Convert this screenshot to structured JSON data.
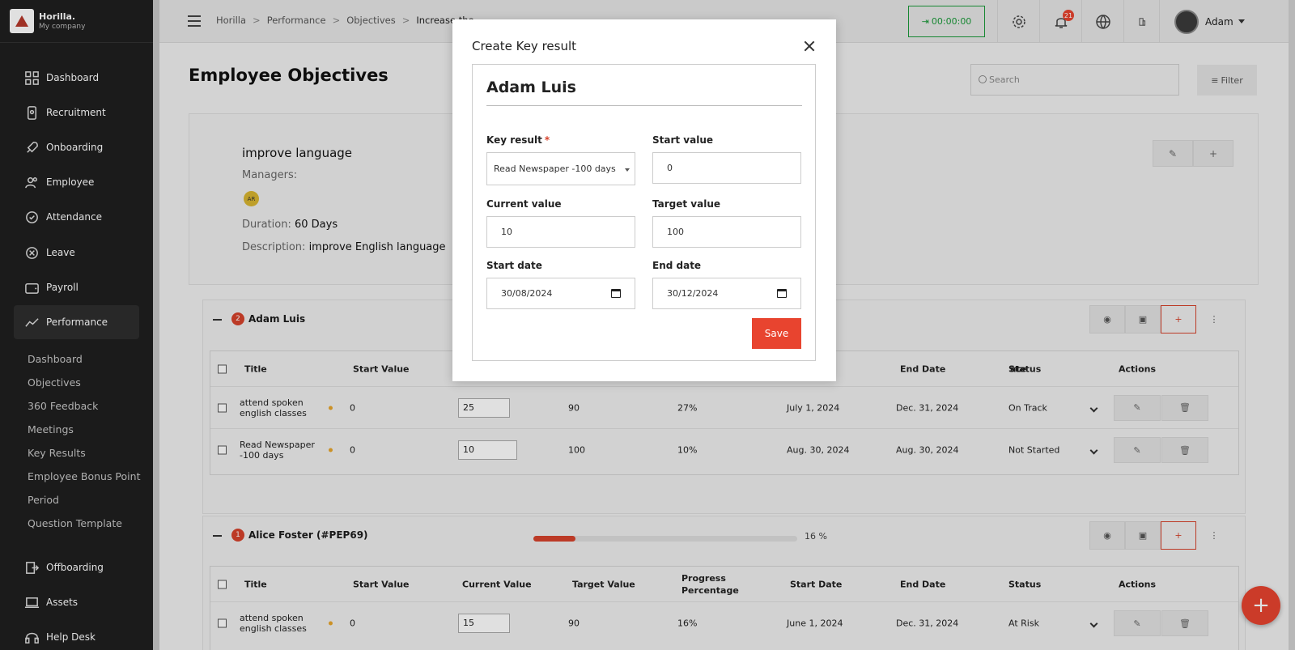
{
  "brand": {
    "name": "Horilla.",
    "company": "My company"
  },
  "sidebar": {
    "items": [
      {
        "label": "Dashboard",
        "icon": "dashboard-icon"
      },
      {
        "label": "Recruitment",
        "icon": "recruitment-icon"
      },
      {
        "label": "Onboarding",
        "icon": "rocket-icon"
      },
      {
        "label": "Employee",
        "icon": "people-icon"
      },
      {
        "label": "Attendance",
        "icon": "check-circle-icon"
      },
      {
        "label": "Leave",
        "icon": "x-circle-icon"
      },
      {
        "label": "Payroll",
        "icon": "wallet-icon"
      },
      {
        "label": "Performance",
        "icon": "trend-icon"
      }
    ],
    "sub_items": [
      "Dashboard",
      "Objectives",
      "360 Feedback",
      "Meetings",
      "Key Results",
      "Employee Bonus Point",
      "Period",
      "Question Template"
    ],
    "bottom_items": [
      {
        "label": "Offboarding",
        "icon": "exit-icon"
      },
      {
        "label": "Assets",
        "icon": "laptop-icon"
      },
      {
        "label": "Help Desk",
        "icon": "headset-icon"
      }
    ]
  },
  "topbar": {
    "breadcrumbs": [
      "Horilla",
      "Performance",
      "Objectives",
      "Increase the"
    ],
    "timer": "00:00:00",
    "notifications_count": "21",
    "user_name": "Adam"
  },
  "page": {
    "title": "Employee Objectives",
    "search_placeholder": "Search",
    "filter_label": "Filter"
  },
  "objective": {
    "title": "improve language",
    "managers_label": "Managers:",
    "manager_initials": "AR",
    "duration_label": "Duration:",
    "duration_value": "60 Days",
    "description_label": "Description:",
    "description_value": "improve English language"
  },
  "groups": [
    {
      "count": "2",
      "name": "Adam Luis",
      "rows": [
        {
          "title": "attend spoken english classes",
          "start": "0",
          "current": "25",
          "target": "90",
          "progress": "27%",
          "start_date": "July 1, 2024",
          "end_date": "Dec. 31, 2024",
          "status": "On Track"
        },
        {
          "title": "Read Newspaper -100 days",
          "start": "0",
          "current": "10",
          "target": "100",
          "progress": "10%",
          "start_date": "Aug. 30, 2024",
          "end_date": "Aug. 30, 2024",
          "status": "Not Started"
        }
      ]
    },
    {
      "count": "1",
      "name": "Alice Foster (#PEP69)",
      "progress_value": 16,
      "progress_text": "16 %",
      "rows": [
        {
          "title": "attend spoken english classes",
          "start": "0",
          "current": "15",
          "target": "90",
          "progress": "16%",
          "start_date": "June 1, 2024",
          "end_date": "Dec. 31, 2024",
          "status": "At Risk"
        }
      ]
    }
  ],
  "table_headers": {
    "title": "Title",
    "start_value": "Start Value",
    "current_value": "Current Value",
    "target_value": "Target Value",
    "progress_1": "Progress",
    "progress_2": "Percentage",
    "start_date": "Start Date",
    "end_date": "End Date",
    "status": "Status",
    "actions": "Actions",
    "partial_date": "ate"
  },
  "modal": {
    "title": "Create Key result",
    "employee": "Adam Luis",
    "key_result_label": "Key result",
    "required_mark": "*",
    "key_result_value": "Read Newspaper -100 days",
    "start_value_label": "Start value",
    "start_value": "0",
    "current_value_label": "Current value",
    "current_value": "10",
    "target_value_label": "Target value",
    "target_value": "100",
    "start_date_label": "Start date",
    "start_date": "30/08/2024",
    "end_date_label": "End date",
    "end_date": "30/12/2024",
    "save_label": "Save"
  },
  "colors": {
    "accent": "#e8442f",
    "success": "#1b9a3a",
    "sidebar_bg": "#1f1f1f"
  }
}
